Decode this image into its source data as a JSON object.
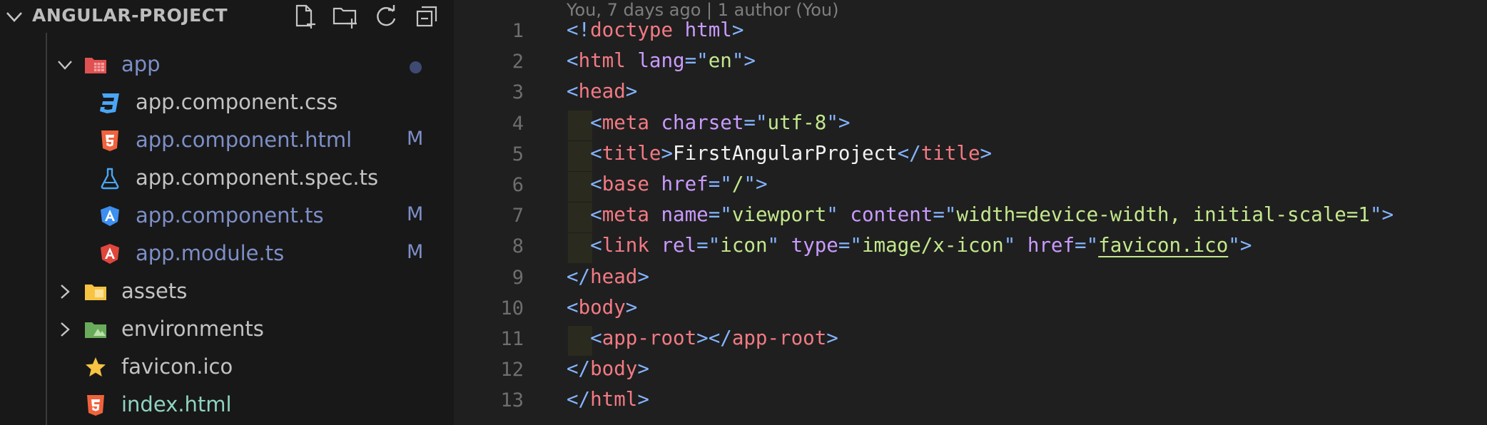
{
  "explorer": {
    "title": "ANGULAR-PROJECT",
    "actions": [
      {
        "name": "new-file-button",
        "icon": "new-file-icon"
      },
      {
        "name": "new-folder-button",
        "icon": "new-folder-icon"
      },
      {
        "name": "refresh-button",
        "icon": "refresh-icon"
      },
      {
        "name": "collapse-all-button",
        "icon": "collapse-all-icon"
      }
    ],
    "tree": [
      {
        "label": "app",
        "type": "folder",
        "expanded": true,
        "icon": "app-folder-icon",
        "status": "modified-dot"
      },
      {
        "label": "app.component.css",
        "type": "file",
        "icon": "css-icon",
        "status": ""
      },
      {
        "label": "app.component.html",
        "type": "file",
        "icon": "html-icon",
        "status": "M"
      },
      {
        "label": "app.component.spec.ts",
        "type": "file",
        "icon": "test-flask-icon",
        "status": ""
      },
      {
        "label": "app.component.ts",
        "type": "file",
        "icon": "angular-component-icon",
        "status": "M"
      },
      {
        "label": "app.module.ts",
        "type": "file",
        "icon": "angular-icon",
        "status": "M"
      },
      {
        "label": "assets",
        "type": "folder",
        "expanded": false,
        "icon": "assets-folder-icon",
        "status": ""
      },
      {
        "label": "environments",
        "type": "folder",
        "expanded": false,
        "icon": "environments-folder-icon",
        "status": ""
      },
      {
        "label": "favicon.ico",
        "type": "file",
        "icon": "star-icon",
        "status": ""
      },
      {
        "label": "index.html",
        "type": "file",
        "icon": "html-icon",
        "status": "added"
      }
    ]
  },
  "editor": {
    "blame": "You, 7 days ago | 1 author (You)",
    "lines": [
      {
        "n": "1",
        "tokens": [
          [
            "p",
            "<!"
          ],
          [
            "t",
            "doctype"
          ],
          [
            "x",
            " "
          ],
          [
            "a",
            "html"
          ],
          [
            "p",
            ">"
          ]
        ]
      },
      {
        "n": "2",
        "tokens": [
          [
            "p",
            "<"
          ],
          [
            "t",
            "html"
          ],
          [
            "x",
            " "
          ],
          [
            "a",
            "lang"
          ],
          [
            "p",
            "=\""
          ],
          [
            "s",
            "en"
          ],
          [
            "p",
            "\">"
          ]
        ]
      },
      {
        "n": "3",
        "tokens": [
          [
            "p",
            "<"
          ],
          [
            "t",
            "head"
          ],
          [
            "p",
            ">"
          ]
        ]
      },
      {
        "n": "4",
        "tokens": [
          [
            "x",
            "  "
          ],
          [
            "p",
            "<"
          ],
          [
            "t",
            "meta"
          ],
          [
            "x",
            " "
          ],
          [
            "a",
            "charset"
          ],
          [
            "p",
            "=\""
          ],
          [
            "s",
            "utf-8"
          ],
          [
            "p",
            "\">"
          ]
        ]
      },
      {
        "n": "5",
        "tokens": [
          [
            "x",
            "  "
          ],
          [
            "p",
            "<"
          ],
          [
            "t",
            "title"
          ],
          [
            "p",
            ">"
          ],
          [
            "w",
            "FirstAngularProject"
          ],
          [
            "p",
            "</"
          ],
          [
            "t",
            "title"
          ],
          [
            "p",
            ">"
          ]
        ]
      },
      {
        "n": "6",
        "tokens": [
          [
            "x",
            "  "
          ],
          [
            "p",
            "<"
          ],
          [
            "t",
            "base"
          ],
          [
            "x",
            " "
          ],
          [
            "a",
            "href"
          ],
          [
            "p",
            "=\""
          ],
          [
            "s",
            "/"
          ],
          [
            "p",
            "\">"
          ]
        ]
      },
      {
        "n": "7",
        "tokens": [
          [
            "x",
            "  "
          ],
          [
            "p",
            "<"
          ],
          [
            "t",
            "meta"
          ],
          [
            "x",
            " "
          ],
          [
            "a",
            "name"
          ],
          [
            "p",
            "=\""
          ],
          [
            "s",
            "viewport"
          ],
          [
            "p",
            "\""
          ],
          [
            "x",
            " "
          ],
          [
            "a",
            "content"
          ],
          [
            "p",
            "=\""
          ],
          [
            "s",
            "width=device-width, initial-scale=1"
          ],
          [
            "p",
            "\">"
          ]
        ]
      },
      {
        "n": "8",
        "tokens": [
          [
            "x",
            "  "
          ],
          [
            "p",
            "<"
          ],
          [
            "t",
            "link"
          ],
          [
            "x",
            " "
          ],
          [
            "a",
            "rel"
          ],
          [
            "p",
            "=\""
          ],
          [
            "s",
            "icon"
          ],
          [
            "p",
            "\""
          ],
          [
            "x",
            " "
          ],
          [
            "a",
            "type"
          ],
          [
            "p",
            "=\""
          ],
          [
            "s",
            "image/x-icon"
          ],
          [
            "p",
            "\""
          ],
          [
            "x",
            " "
          ],
          [
            "a",
            "href"
          ],
          [
            "p",
            "=\""
          ],
          [
            "l",
            "favicon.ico"
          ],
          [
            "p",
            "\">"
          ]
        ]
      },
      {
        "n": "9",
        "tokens": [
          [
            "p",
            "</"
          ],
          [
            "t",
            "head"
          ],
          [
            "p",
            ">"
          ]
        ]
      },
      {
        "n": "10",
        "tokens": [
          [
            "p",
            "<"
          ],
          [
            "t",
            "body"
          ],
          [
            "p",
            ">"
          ]
        ]
      },
      {
        "n": "11",
        "tokens": [
          [
            "x",
            "  "
          ],
          [
            "p",
            "<"
          ],
          [
            "t",
            "app-root"
          ],
          [
            "p",
            "></"
          ],
          [
            "t",
            "app-root"
          ],
          [
            "p",
            ">"
          ]
        ]
      },
      {
        "n": "12",
        "tokens": [
          [
            "p",
            "</"
          ],
          [
            "t",
            "body"
          ],
          [
            "p",
            ">"
          ]
        ]
      },
      {
        "n": "13",
        "tokens": [
          [
            "p",
            "</"
          ],
          [
            "t",
            "html"
          ],
          [
            "p",
            ">"
          ]
        ]
      }
    ]
  }
}
